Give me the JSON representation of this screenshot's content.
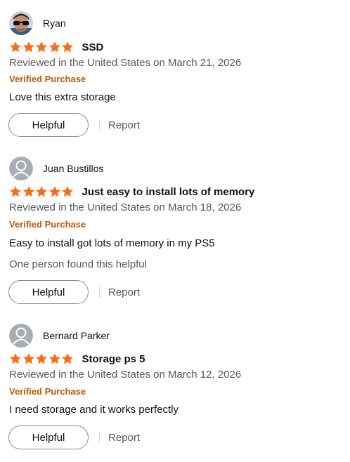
{
  "colors": {
    "star": "#ff6a13",
    "verified": "#c45500",
    "text": "#0f1111",
    "muted": "#565959"
  },
  "reviews": [
    {
      "author": "Ryan",
      "avatar_icon": "user-photo",
      "rating": 5,
      "title": "SSD",
      "meta": "Reviewed in the United States on March 21, 2026",
      "verified": "Verified Purchase",
      "body": "Love this extra storage",
      "helpful_count": "",
      "helpful_label": "Helpful",
      "report_label": "Report"
    },
    {
      "author": "Juan Bustillos",
      "avatar_icon": "default-avatar",
      "rating": 5,
      "title": "Just easy to install lots of memory",
      "meta": "Reviewed in the United States on March 18, 2026",
      "verified": "Verified Purchase",
      "body": "Easy to install got lots of memory in my PS5",
      "helpful_count": "One person found this helpful",
      "helpful_label": "Helpful",
      "report_label": "Report"
    },
    {
      "author": "Bernard Parker",
      "avatar_icon": "default-avatar",
      "rating": 5,
      "title": "Storage ps 5",
      "meta": "Reviewed in the United States on March 12, 2026",
      "verified": "Verified Purchase",
      "body": "I need storage and it works perfectly",
      "helpful_count": "",
      "helpful_label": "Helpful",
      "report_label": "Report"
    }
  ]
}
